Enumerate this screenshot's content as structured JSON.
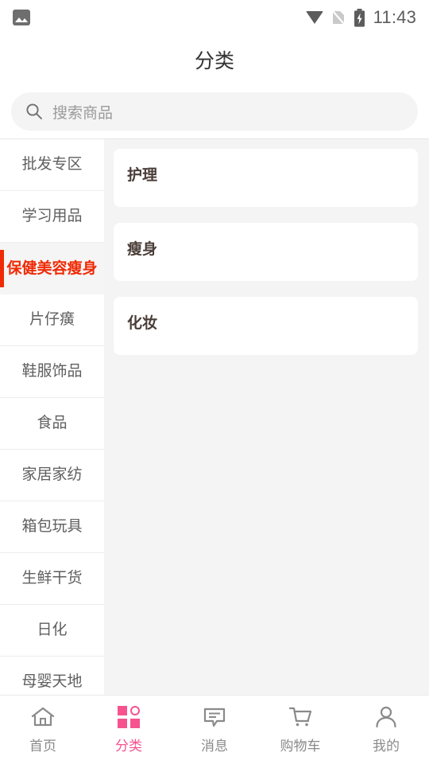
{
  "statusbar": {
    "time": "11:43",
    "icons": [
      "image-icon",
      "wifi-icon",
      "sim-off-icon",
      "battery-charging-icon"
    ]
  },
  "header": {
    "title": "分类"
  },
  "search": {
    "placeholder": "搜索商品",
    "value": "",
    "icon": "search-icon"
  },
  "sidebar": {
    "selected_index": 2,
    "items": [
      {
        "label": "批发专区"
      },
      {
        "label": "学习用品"
      },
      {
        "label": "保健美容瘦身"
      },
      {
        "label": "片仔癀"
      },
      {
        "label": "鞋服饰品"
      },
      {
        "label": "食品"
      },
      {
        "label": "家居家纺"
      },
      {
        "label": "箱包玩具"
      },
      {
        "label": "生鲜干货"
      },
      {
        "label": "日化"
      },
      {
        "label": "母婴天地"
      }
    ]
  },
  "panel": {
    "cards": [
      {
        "title": "护理"
      },
      {
        "title": "瘦身"
      },
      {
        "title": "化妆"
      }
    ]
  },
  "bottomnav": {
    "active_index": 1,
    "active_color": "#f5528f",
    "inactive_color": "#8a8a8a",
    "items": [
      {
        "label": "首页",
        "icon": "home-icon"
      },
      {
        "label": "分类",
        "icon": "grid-icon"
      },
      {
        "label": "消息",
        "icon": "message-icon"
      },
      {
        "label": "购物车",
        "icon": "cart-icon"
      },
      {
        "label": "我的",
        "icon": "person-icon"
      }
    ]
  }
}
